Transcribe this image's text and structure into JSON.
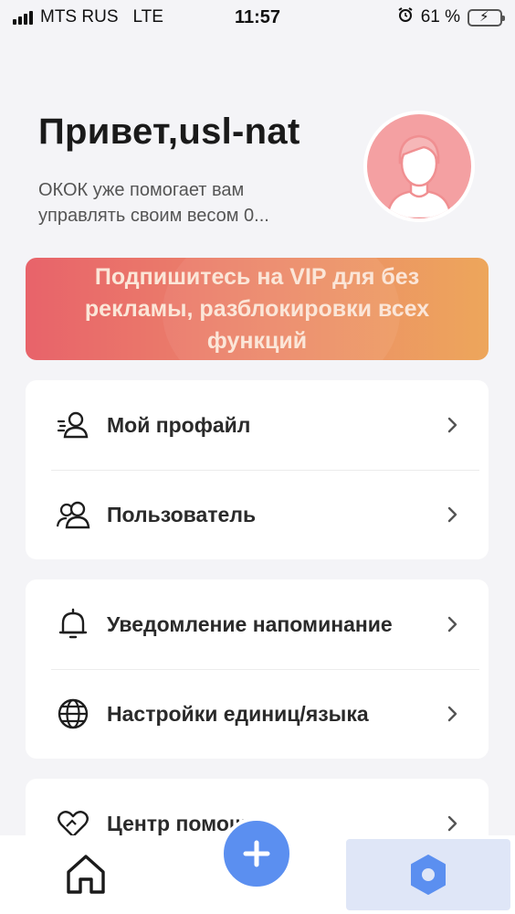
{
  "status_bar": {
    "carrier": "MTS RUS",
    "network": "LTE",
    "time": "11:57",
    "battery_percent": "61 %",
    "battery_level": 0.61
  },
  "header": {
    "greeting": "Привет,usl-nat",
    "subtitle": "ОКОК уже помогает вам управлять своим весом 0..."
  },
  "vip_banner": {
    "text": "Подпишитесь на VIP для без рекламы, разблокировки всех функций"
  },
  "menu": {
    "group1": [
      {
        "label": "Мой профайл",
        "icon": "profile-icon"
      },
      {
        "label": "Пользователь",
        "icon": "users-icon"
      }
    ],
    "group2": [
      {
        "label": "Уведомление напоминание",
        "icon": "bell-icon"
      },
      {
        "label": "Настройки единиц/языка",
        "icon": "globe-icon"
      }
    ],
    "group3": [
      {
        "label": "Центр помощи",
        "icon": "heart-help-icon"
      }
    ]
  },
  "tabbar": {
    "items": [
      "home-icon",
      "add-icon",
      "settings-hex-icon"
    ],
    "active": "settings-hex-icon"
  },
  "colors": {
    "accent": "#5b8ff0",
    "banner_start": "#e8636a",
    "banner_end": "#eda65b",
    "avatar_bg": "#f4a0a2"
  }
}
